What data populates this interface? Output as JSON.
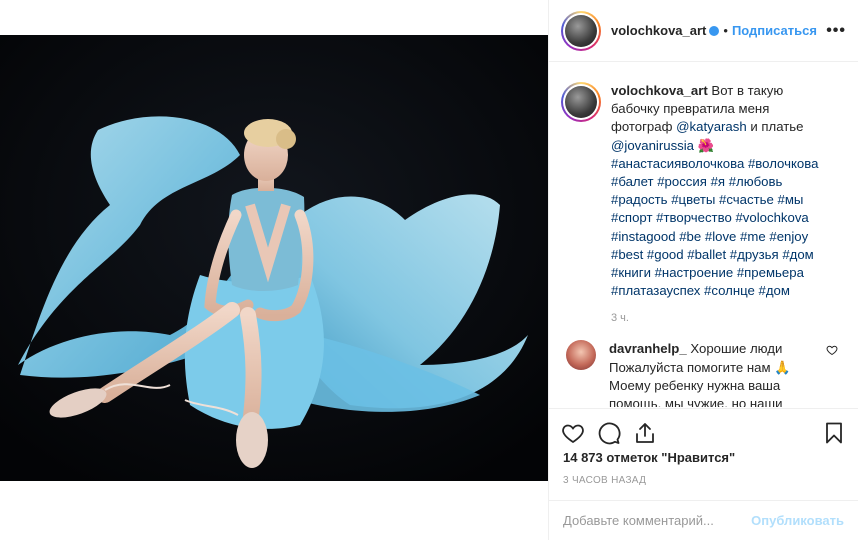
{
  "post": {
    "username": "volochkova_art",
    "dot": "•",
    "follow_label": "Подписаться",
    "more_label": "•••"
  },
  "caption": {
    "username": "volochkova_art",
    "text_1": " Вот в такую бабочку превратила меня фотограф ",
    "mention_1": "@katyarash",
    "text_2": " и платье ",
    "mention_2": "@jovanirussia",
    "emoji": " 🌺",
    "hashtags": " #анастасияволочкова #волочкова #балет #россия #я #любовь #радость #цветы #счастье #мы #спорт #творчество #volochkova #instagood #be #love #me #enjoy #best #good #ballet #друзья #дом #книги #настроение #премьера #платазауспех #солнце #дом",
    "time": "3 ч."
  },
  "comment": {
    "username": "davranhelp_",
    "text": " Хорошие люди Пожалуйста помогите нам 🙏 Моему ребенку нужна ваша помощь, мы чужие, но наши дети не чужие, Очень прощу"
  },
  "stats": {
    "likes": "14 873 отметок \"Нравится\"",
    "time_ago": "3 часов назад"
  },
  "add_comment": {
    "placeholder": "Добавьте комментарий...",
    "publish_label": "Опубликовать"
  },
  "icons": {
    "like": "heart-icon",
    "comment": "comment-icon",
    "share": "share-icon",
    "save": "bookmark-icon",
    "verified": "verified-badge-icon"
  },
  "colors": {
    "link_blue": "#3897f0",
    "mention": "#003569",
    "dress": "#8fd3ef",
    "background": "#06080c"
  }
}
